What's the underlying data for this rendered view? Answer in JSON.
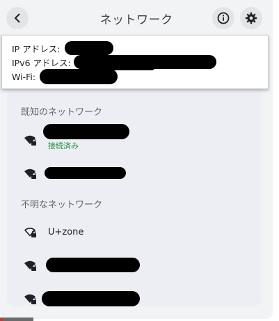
{
  "title": "ネットワーク",
  "icons": {
    "back": "arrow-left-icon",
    "info": "info-icon",
    "settings": "gear-icon",
    "wifi": "wifi-lock-icon"
  },
  "info": {
    "ip_label": "IP アドレス:",
    "ipv6_label": "IPv6 アドレス:",
    "wifi_label": "Wi-Fi:"
  },
  "known": {
    "header": "既知のネットワーク",
    "networks": [
      {
        "status": "接続済み"
      },
      {
        "status": ""
      }
    ]
  },
  "unknown": {
    "header": "不明なネットワーク",
    "networks": [
      {
        "name": "U+zone"
      },
      {
        "name": ""
      },
      {
        "name": ""
      }
    ]
  },
  "colors": {
    "accent_connected": "#1e8e3e",
    "redaction": "#000000"
  }
}
